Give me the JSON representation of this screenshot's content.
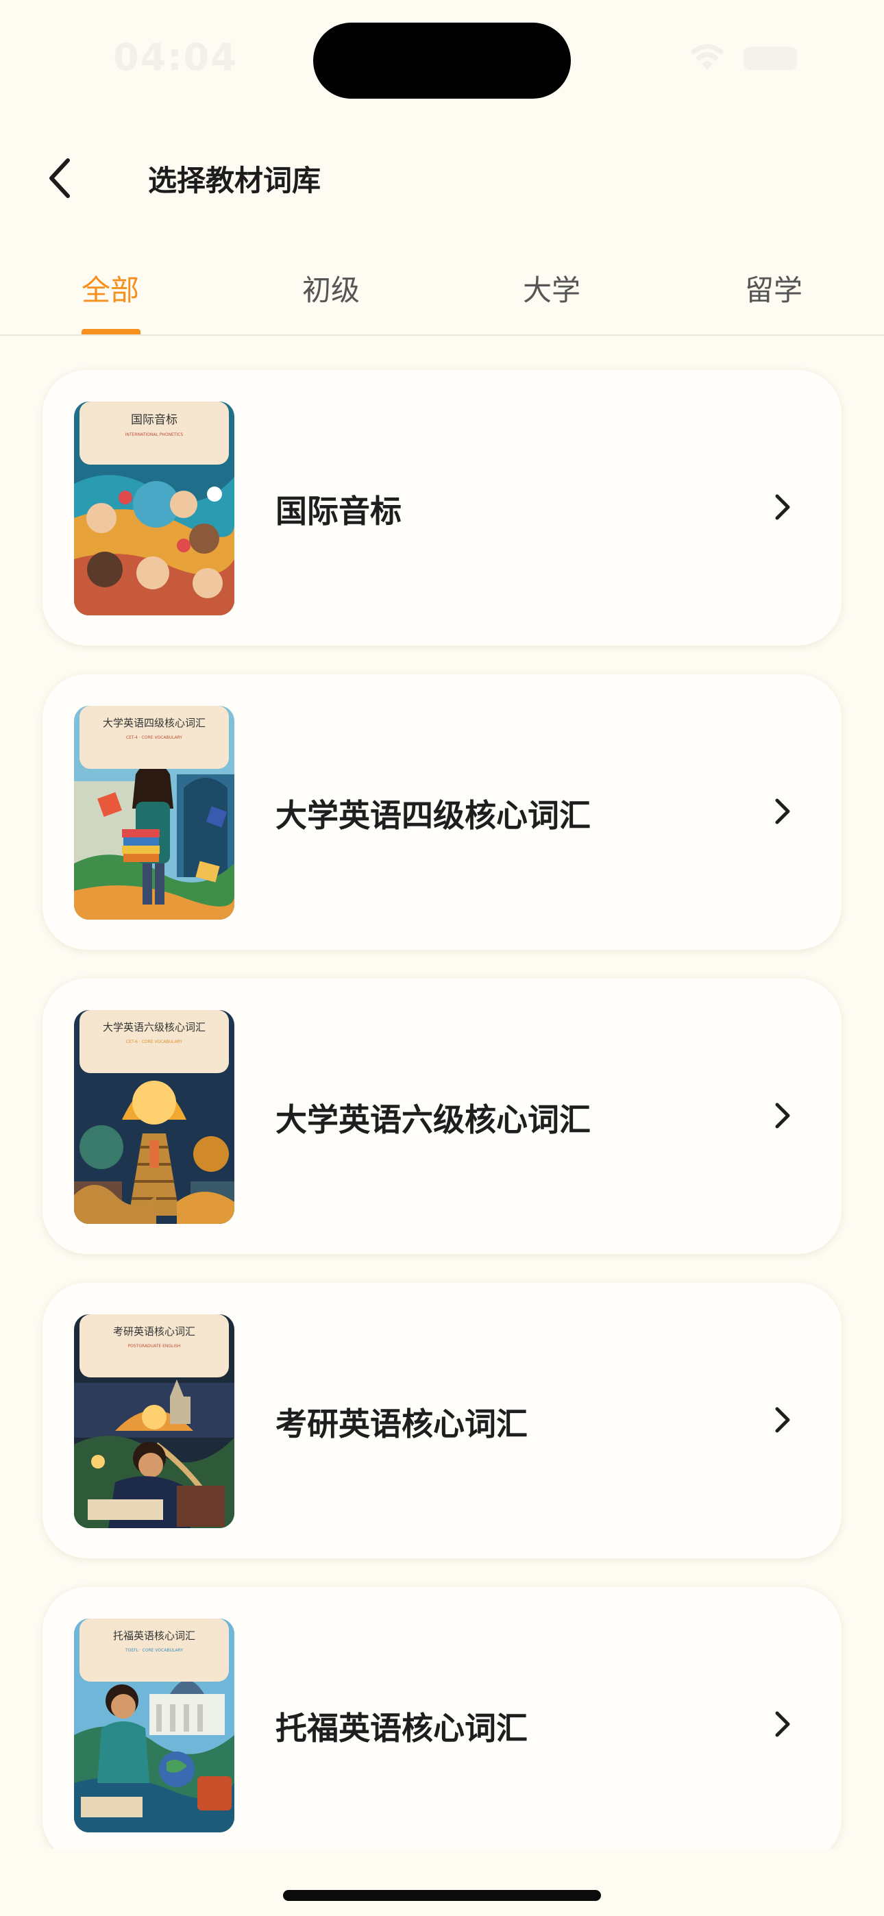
{
  "status_bar": {
    "time": "04:04",
    "wifi_icon": "wifi-icon",
    "battery_icon": "battery-icon"
  },
  "nav": {
    "back_icon": "chevron-left-icon",
    "title": "选择教材词库"
  },
  "tabs": {
    "items": [
      {
        "label": "全部",
        "active": true
      },
      {
        "label": "初级",
        "active": false
      },
      {
        "label": "大学",
        "active": false
      },
      {
        "label": "留学",
        "active": false
      }
    ],
    "active_color": "#f5901e"
  },
  "books": [
    {
      "title": "国际音标",
      "cover_title": "国际音标",
      "cover_subtitle": "INTERNATIONAL PHONETICS",
      "cover_accent": "#c0503a"
    },
    {
      "title": "大学英语四级核心词汇",
      "cover_title": "大学英语四级核心词汇",
      "cover_subtitle": "CET-4 · CORE VOCABULARY",
      "cover_accent": "#c0503a"
    },
    {
      "title": "大学英语六级核心词汇",
      "cover_title": "大学英语六级核心词汇",
      "cover_subtitle": "CET-6 · CORE VOCABULARY",
      "cover_accent": "#d8922a"
    },
    {
      "title": "考研英语核心词汇",
      "cover_title": "考研英语核心词汇",
      "cover_subtitle": "POSTGRADUATE ENGLISH",
      "cover_accent": "#c0503a"
    },
    {
      "title": "托福英语核心词汇",
      "cover_title": "托福英语核心词汇",
      "cover_subtitle": "TOEFL · CORE VOCABULARY",
      "cover_accent": "#3a8fb8"
    }
  ],
  "colors": {
    "background": "#fdfbf2",
    "card": "#fffefa",
    "accent": "#f5901e"
  }
}
